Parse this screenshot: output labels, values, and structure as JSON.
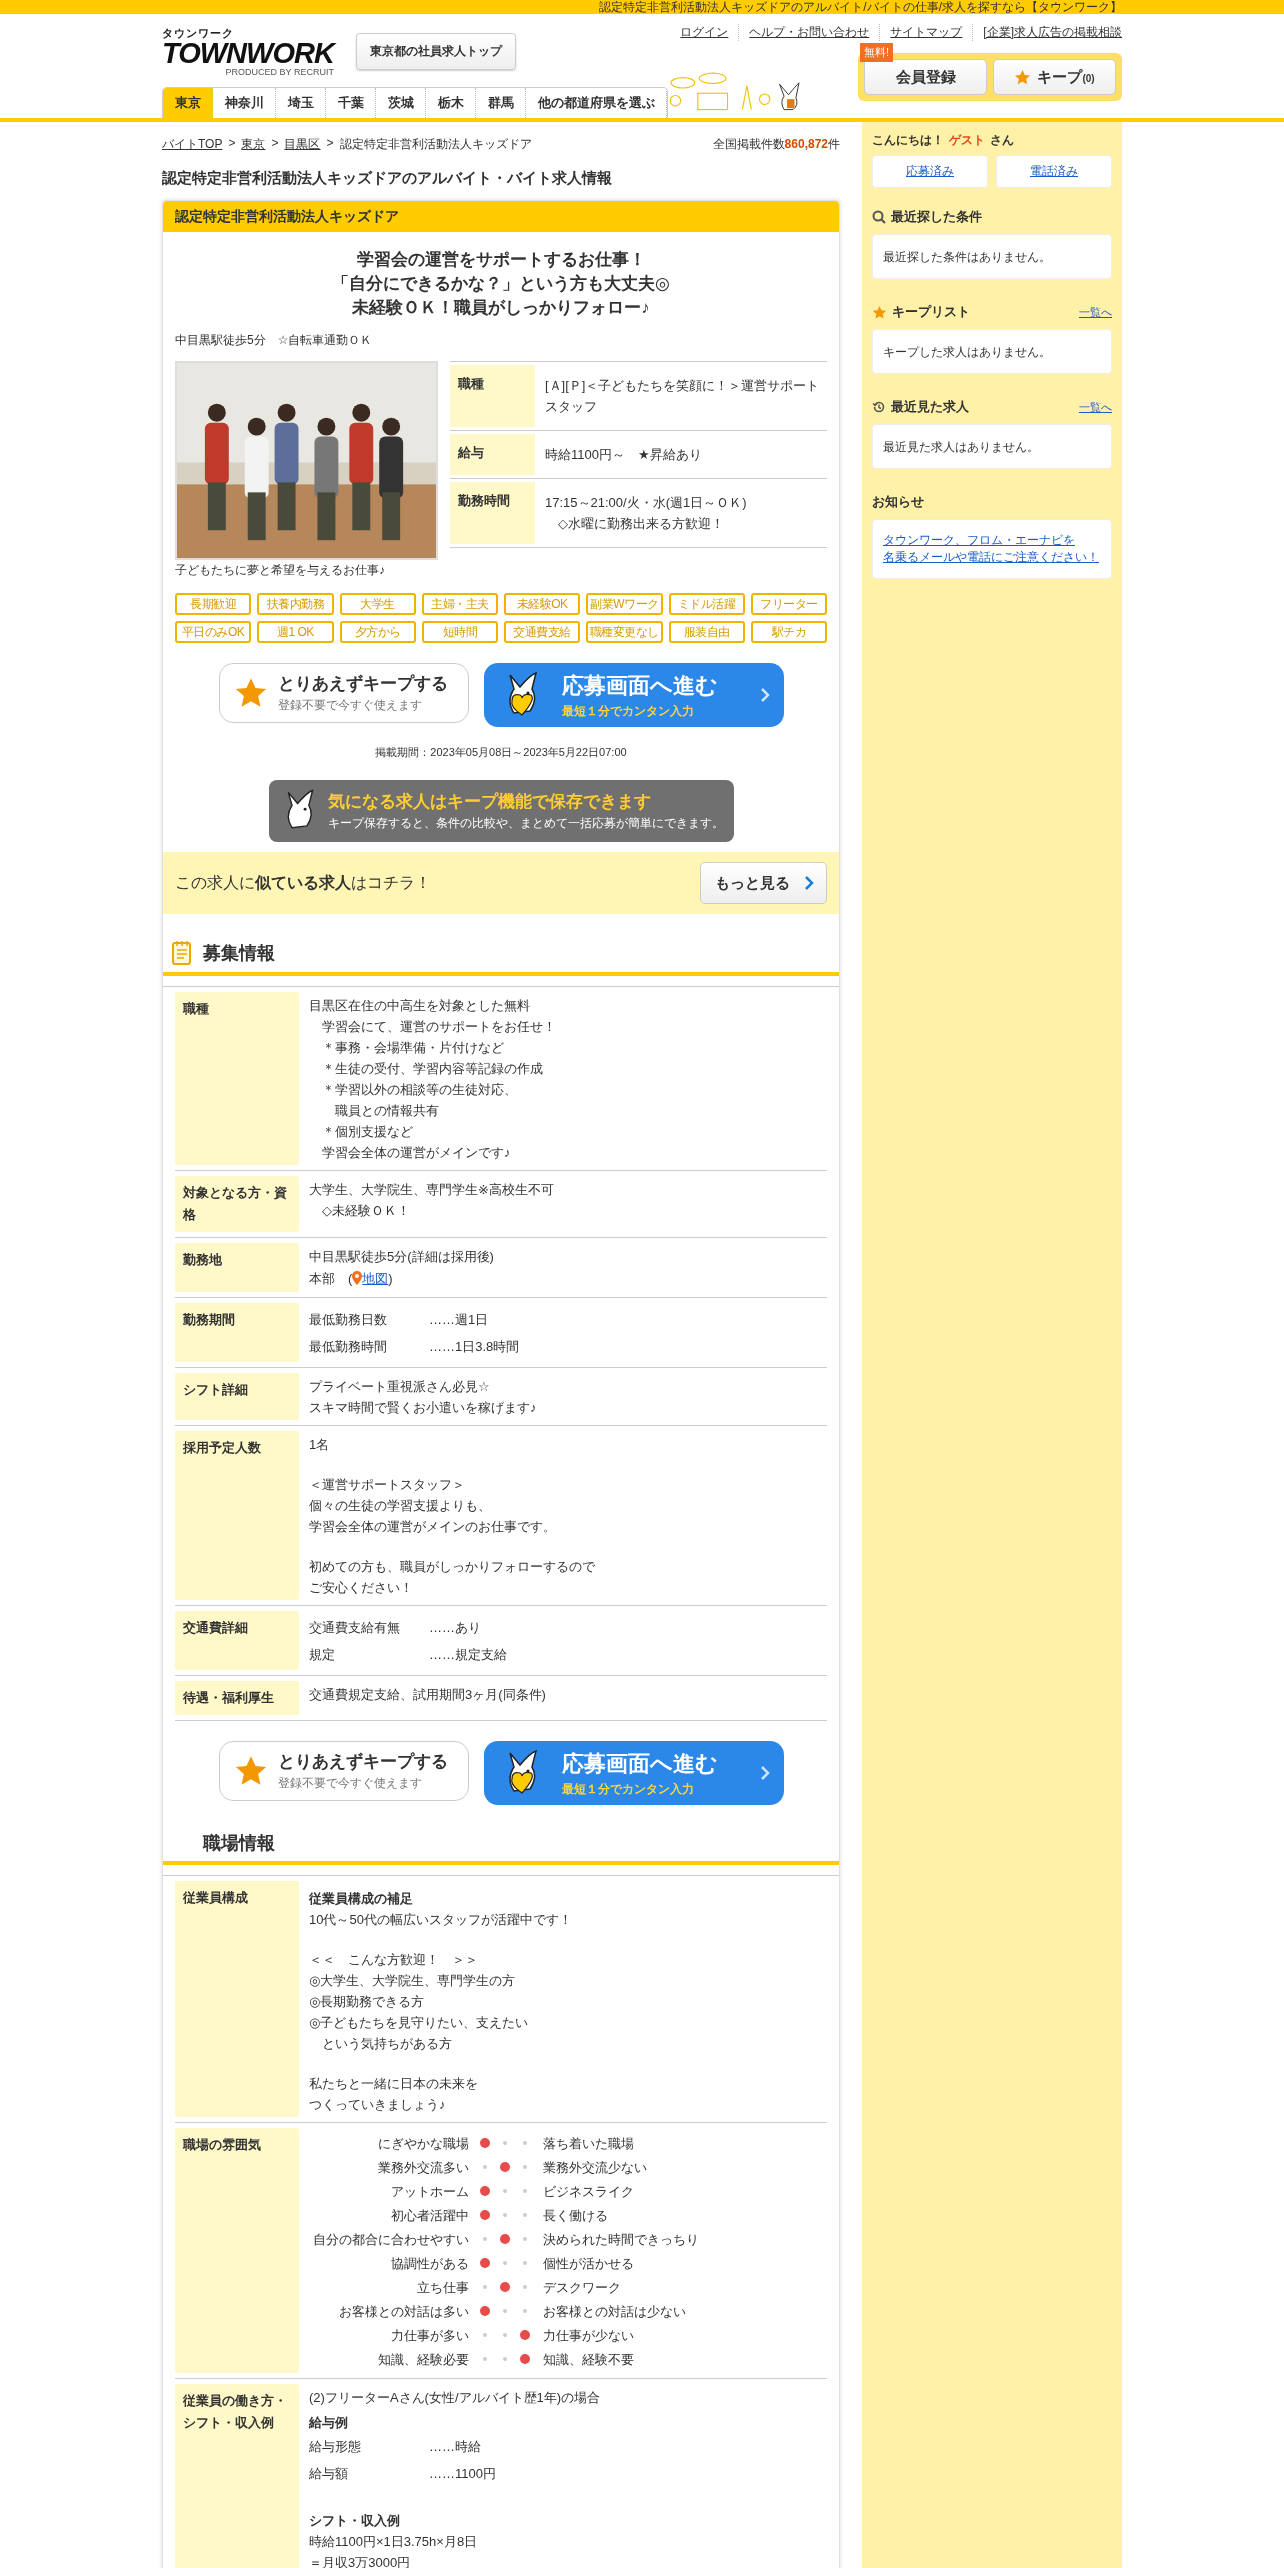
{
  "top_strip": "認定特定非営利活動法人キッズドアのアルバイト/バイトの仕事/求人を探すなら【タウンワーク】",
  "logo": {
    "kana": "タウンワーク",
    "word": "TOWNWORK",
    "byline": "PRODUCED BY RECRUIT"
  },
  "header_button": "東京都の社員求人トップ",
  "header_links": [
    "ログイン",
    "ヘルプ・お問い合わせ",
    "サイトマップ",
    "[企業]求人広告の掲載相談"
  ],
  "member": {
    "badge": "無料!",
    "register": "会員登録",
    "keep": "キープ",
    "keep_count": "(0)"
  },
  "region_tabs": [
    {
      "label": "東京",
      "selected": true
    },
    {
      "label": "神奈川",
      "selected": false
    },
    {
      "label": "埼玉",
      "selected": false
    },
    {
      "label": "千葉",
      "selected": false
    },
    {
      "label": "茨城",
      "selected": false
    },
    {
      "label": "栃木",
      "selected": false
    },
    {
      "label": "群馬",
      "selected": false
    },
    {
      "label": "他の都道府県を選ぶ",
      "selected": false
    }
  ],
  "breadcrumb": {
    "links": [
      "バイトTOP",
      "東京",
      "目黒区"
    ],
    "separator": ">",
    "current": "認定特定非営利活動法人キッズドア"
  },
  "total": {
    "label": "全国掲載件数",
    "count": "860,872",
    "unit": "件"
  },
  "page_title": "認定特定非営利活動法人キッズドアのアルバイト・バイト求人情報",
  "job": {
    "company": "認定特定非営利活動法人キッズドア",
    "catch": [
      "学習会の運営をサポートするお仕事！",
      "「自分にできるかな？」という方も大丈夫◎",
      "未経験ＯＫ！職員がしっかりフォロー♪"
    ],
    "access": "中目黒駅徒歩5分　☆自転車通勤ＯＫ",
    "photo": {
      "kind": "picture",
      "caption": "子どもたちに夢と希望を与えるお仕事♪"
    },
    "summary": [
      {
        "label": "職種",
        "lines": [
          "[Ａ][Ｐ]＜子どもたちを笑顔に！＞運営サポートスタッフ"
        ]
      },
      {
        "label": "給与",
        "lines": [
          "時給1100円～　★昇給あり"
        ]
      },
      {
        "label": "勤務時間",
        "lines": [
          "17:15～21:00/火・水(週1日～ＯＫ)",
          "　◇水曜に勤務出来る方歓迎！"
        ]
      }
    ],
    "tags": [
      "長期歓迎",
      "扶養内勤務",
      "大学生",
      "主婦・主夫",
      "未経験OK",
      "副業Wワーク",
      "ミドル活躍",
      "フリーター",
      "平日のみOK",
      "週1 OK",
      "夕方から",
      "短時間",
      "交通費支給",
      "職種変更なし",
      "服装自由",
      "駅チカ"
    ],
    "actions": [
      {
        "keep_title": "とりあえずキープする",
        "keep_sub": "登録不要で今すぐ使えます",
        "apply_title": "応募画面へ進む",
        "apply_sub": "最短１分でカンタン入力"
      },
      {
        "keep_title": "とりあえずキープする",
        "keep_sub": "登録不要で今すぐ使えます",
        "apply_title": "応募画面へ進む",
        "apply_sub": "最短１分でカンタン入力"
      }
    ],
    "period": "掲載期間：2023年05月08日～2023年5月22日07:00",
    "keep_banner": {
      "title": "気になる求人はキープ機能で保存できます",
      "text": "キープ保存すると、条件の比較や、まとめて一括応募が簡単にできます。"
    },
    "similar": {
      "text": "この求人に**似ている求人**はコチラ！",
      "button": "もっと見る"
    }
  },
  "sections": [
    {
      "title": "募集情報",
      "icon": true,
      "rows": [
        {
          "label": "職種",
          "blocks": [
            {
              "kind": "line",
              "text": "目黒区在住の中高生を対象とした無料"
            },
            {
              "kind": "line",
              "text": "　学習会にて、運営のサポートをお任せ！"
            },
            {
              "kind": "line",
              "text": "　＊事務・会場準備・片付けなど"
            },
            {
              "kind": "line",
              "text": "　＊生徒の受付、学習内容等記録の作成"
            },
            {
              "kind": "line",
              "text": "　＊学習以外の相談等の生徒対応、"
            },
            {
              "kind": "line",
              "text": "　　職員との情報共有"
            },
            {
              "kind": "line",
              "text": "　＊個別支援など"
            },
            {
              "kind": "line",
              "text": "　学習会全体の運営がメインです♪"
            }
          ]
        },
        {
          "label": "対象となる方・資格",
          "blocks": [
            {
              "kind": "line",
              "text": "大学生、大学院生、専門学生※高校生不可"
            },
            {
              "kind": "line",
              "text": "　◇未経験ＯＫ！"
            }
          ]
        },
        {
          "label": "勤務地",
          "blocks": [
            {
              "kind": "line",
              "text": "中目黒駅徒歩5分(詳細は採用後)"
            },
            {
              "kind": "place",
              "prefix": "本部　(",
              "link": "地図",
              "suffix": ")"
            }
          ]
        },
        {
          "label": "勤務期間",
          "blocks": [
            {
              "kind": "pair",
              "key": "最低勤務日数",
              "value": "……週1日"
            },
            {
              "kind": "pair",
              "key": "最低勤務時間",
              "value": "……1日3.8時間"
            }
          ]
        },
        {
          "label": "シフト詳細",
          "blocks": [
            {
              "kind": "line",
              "text": "プライベート重視派さん必見☆"
            },
            {
              "kind": "line",
              "text": "スキマ時間で賢くお小遣いを稼げます♪"
            }
          ]
        },
        {
          "label": "採用予定人数",
          "blocks": [
            {
              "kind": "line",
              "text": "1名"
            },
            {
              "kind": "gap"
            },
            {
              "kind": "line",
              "text": "＜運営サポートスタッフ＞"
            },
            {
              "kind": "line",
              "text": "個々の生徒の学習支援よりも、"
            },
            {
              "kind": "line",
              "text": "学習会全体の運営がメインのお仕事です。"
            },
            {
              "kind": "gap"
            },
            {
              "kind": "line",
              "text": "初めての方も、職員がしっかりフォローするので"
            },
            {
              "kind": "line",
              "text": "ご安心ください！"
            }
          ]
        },
        {
          "label": "交通費詳細",
          "blocks": [
            {
              "kind": "pair",
              "key": "交通費支給有無",
              "value": "……あり"
            },
            {
              "kind": "pair",
              "key": "規定",
              "value": "……規定支給"
            }
          ]
        },
        {
          "label": "待遇・福利厚生",
          "blocks": [
            {
              "kind": "line",
              "text": "交通費規定支給、試用期間3ヶ月(同条件)"
            }
          ]
        }
      ]
    },
    {
      "title": "職場情報",
      "icon": false,
      "rows": [
        {
          "label": "従業員構成",
          "blocks": [
            {
              "kind": "heading",
              "text": "従業員構成の補足"
            },
            {
              "kind": "line",
              "text": "10代～50代の幅広いスタッフが活躍中です！"
            },
            {
              "kind": "gap"
            },
            {
              "kind": "line",
              "text": "＜＜　こんな方歓迎！　＞＞"
            },
            {
              "kind": "line",
              "text": "◎大学生、大学院生、専門学生の方"
            },
            {
              "kind": "line",
              "text": "◎長期勤務できる方"
            },
            {
              "kind": "line",
              "text": "◎子どもたちを見守りたい、支えたい"
            },
            {
              "kind": "line",
              "text": "　という気持ちがある方"
            },
            {
              "kind": "gap"
            },
            {
              "kind": "line",
              "text": "私たちと一緒に日本の未来を"
            },
            {
              "kind": "line",
              "text": "つくっていきましょう♪"
            }
          ]
        },
        {
          "label": "職場の雰囲気",
          "scales": [
            {
              "left": "にぎやかな職場",
              "right": "落ち着いた職場",
              "dots": [
                {
                  "selected": true
                },
                {
                  "selected": false
                },
                {
                  "selected": false
                }
              ]
            },
            {
              "left": "業務外交流多い",
              "right": "業務外交流少ない",
              "dots": [
                {
                  "selected": false
                },
                {
                  "selected": true
                },
                {
                  "selected": false
                }
              ]
            },
            {
              "left": "アットホーム",
              "right": "ビジネスライク",
              "dots": [
                {
                  "selected": true
                },
                {
                  "selected": false
                },
                {
                  "selected": false
                }
              ]
            },
            {
              "left": "初心者活躍中",
              "right": "長く働ける",
              "dots": [
                {
                  "selected": true
                },
                {
                  "selected": false
                },
                {
                  "selected": false
                }
              ]
            },
            {
              "left": "自分の都合に合わせやすい",
              "right": "決められた時間できっちり",
              "dots": [
                {
                  "selected": false
                },
                {
                  "selected": true
                },
                {
                  "selected": false
                }
              ]
            },
            {
              "left": "協調性がある",
              "right": "個性が活かせる",
              "dots": [
                {
                  "selected": true
                },
                {
                  "selected": false
                },
                {
                  "selected": false
                }
              ]
            },
            {
              "left": "立ち仕事",
              "right": "デスクワーク",
              "dots": [
                {
                  "selected": false
                },
                {
                  "selected": true
                },
                {
                  "selected": false
                }
              ]
            },
            {
              "left": "お客様との対話は多い",
              "right": "お客様との対話は少ない",
              "dots": [
                {
                  "selected": true
                },
                {
                  "selected": false
                },
                {
                  "selected": false
                }
              ]
            },
            {
              "left": "力仕事が多い",
              "right": "力仕事が少ない",
              "dots": [
                {
                  "selected": false
                },
                {
                  "selected": false
                },
                {
                  "selected": true
                }
              ]
            },
            {
              "left": "知識、経験必要",
              "right": "知識、経験不要",
              "dots": [
                {
                  "selected": false
                },
                {
                  "selected": false
                },
                {
                  "selected": true
                }
              ]
            }
          ]
        },
        {
          "label": "従業員の働き方・シフト・収入例",
          "blocks": [
            {
              "kind": "line",
              "text": "(2)フリーターAさん(女性/アルバイト歴1年)の場合"
            },
            {
              "kind": "heading",
              "text": "給与例"
            },
            {
              "kind": "pair",
              "key": "給与形態",
              "value": "……時給"
            },
            {
              "kind": "pair",
              "key": "給与額",
              "value": "……1100円"
            },
            {
              "kind": "gap"
            },
            {
              "kind": "heading",
              "text": "シフト・収入例"
            },
            {
              "kind": "line",
              "text": "時給1100円×1日3.75h×月8日"
            },
            {
              "kind": "line",
              "text": "＝月収3万3000円"
            }
          ]
        }
      ]
    }
  ],
  "sidebar": {
    "greeting": {
      "prefix": "こんにちは！",
      "name": "ゲスト",
      "suffix": "さん"
    },
    "history_buttons": [
      "応募済み",
      "電話済み"
    ],
    "panels": [
      {
        "kind": "search",
        "title": "最近探した条件",
        "message": "最近探した条件はありません。"
      },
      {
        "kind": "keep",
        "title": "キープリスト",
        "link": "一覧へ",
        "message": "キープした求人はありません。"
      },
      {
        "kind": "history",
        "title": "最近見た求人",
        "link": "一覧へ",
        "message": "最近見た求人はありません。"
      },
      {
        "kind": "notice",
        "title": "お知らせ",
        "link_lines": [
          "タウンワーク、フロム・エーナビを",
          "名乗るメールや電話にご注意ください！"
        ]
      }
    ]
  }
}
